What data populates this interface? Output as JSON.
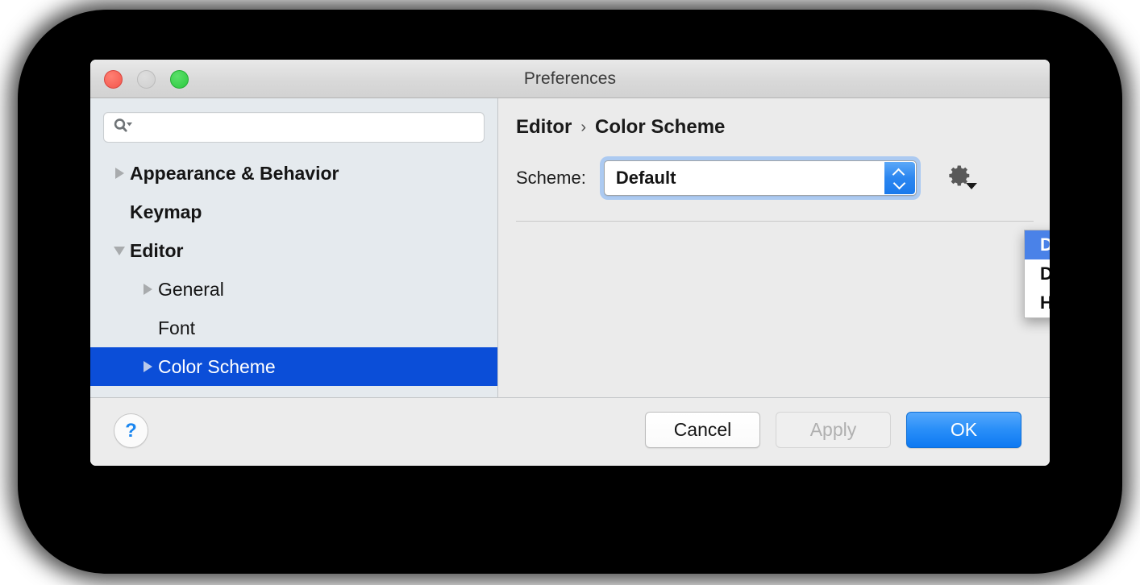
{
  "window": {
    "title": "Preferences",
    "traffic_lights": [
      "close-button",
      "minimize-button",
      "zoom-button"
    ]
  },
  "sidebar": {
    "search": {
      "value": "",
      "placeholder": ""
    },
    "items": [
      {
        "label": "Appearance & Behavior",
        "level": 0,
        "twisty": "right",
        "selected": false
      },
      {
        "label": "Keymap",
        "level": 0,
        "twisty": "none",
        "selected": false
      },
      {
        "label": "Editor",
        "level": 0,
        "twisty": "down",
        "selected": false
      },
      {
        "label": "General",
        "level": 1,
        "twisty": "right",
        "selected": false
      },
      {
        "label": "Font",
        "level": 1,
        "twisty": "none",
        "selected": false
      },
      {
        "label": "Color Scheme",
        "level": 1,
        "twisty": "right",
        "selected": true
      }
    ]
  },
  "content": {
    "breadcrumb": {
      "parent": "Editor",
      "separator": "›",
      "current": "Color Scheme"
    },
    "scheme": {
      "label": "Scheme:",
      "value": "Default",
      "options": [
        "Default",
        "Darcula",
        "High contrast"
      ],
      "highlighted_option": "Default",
      "gear_icon": "gear-icon"
    }
  },
  "footer": {
    "help_label": "?",
    "cancel_label": "Cancel",
    "apply_label": "Apply",
    "ok_label": "OK"
  },
  "colors": {
    "selection_blue": "#0b4ed8",
    "menu_highlight_blue": "#4a82e8",
    "primary_button_blue": "#1a86f0",
    "sidebar_bg": "#e5eaee",
    "content_bg": "#ebebeb"
  }
}
